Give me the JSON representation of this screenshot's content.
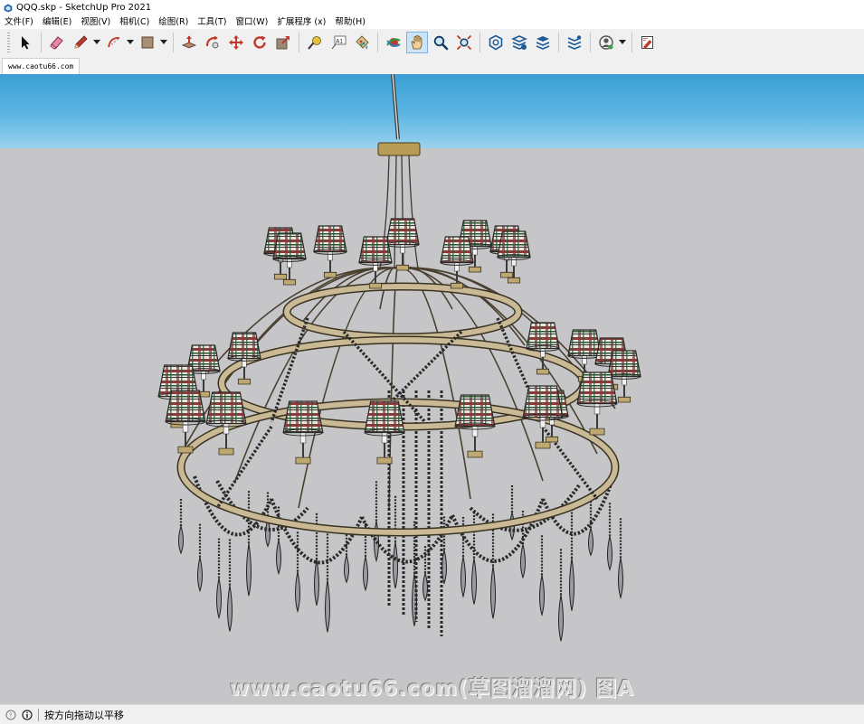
{
  "window": {
    "title": "QQQ.skp - SketchUp Pro 2021"
  },
  "menu": [
    {
      "label": "文件(F)"
    },
    {
      "label": "编辑(E)"
    },
    {
      "label": "视图(V)"
    },
    {
      "label": "相机(C)"
    },
    {
      "label": "绘图(R)"
    },
    {
      "label": "工具(T)"
    },
    {
      "label": "窗口(W)"
    },
    {
      "label": "扩展程序 (x)"
    },
    {
      "label": "帮助(H)"
    }
  ],
  "toolbar": {
    "tools": [
      {
        "name": "select-tool",
        "icon": "arrow-cursor-icon"
      },
      {
        "name": "eraser-tool",
        "icon": "eraser-icon"
      },
      {
        "name": "line-tool",
        "icon": "pencil-icon"
      },
      {
        "name": "arc-tool",
        "icon": "arc-icon"
      },
      {
        "name": "rectangle-tool",
        "icon": "rectangle-icon"
      },
      {
        "name": "push-pull-tool",
        "icon": "push-pull-icon"
      },
      {
        "name": "follow-me-tool",
        "icon": "follow-me-icon"
      },
      {
        "name": "move-tool",
        "icon": "move-icon"
      },
      {
        "name": "rotate-tool",
        "icon": "rotate-icon"
      },
      {
        "name": "scale-tool",
        "icon": "scale-icon"
      },
      {
        "name": "tape-measure-tool",
        "icon": "tape-measure-icon"
      },
      {
        "name": "text-tool",
        "icon": "text-icon"
      },
      {
        "name": "paint-bucket-tool",
        "icon": "paint-bucket-icon"
      },
      {
        "name": "orbit-tool",
        "icon": "orbit-icon"
      },
      {
        "name": "pan-tool",
        "icon": "pan-hand-icon",
        "active": true
      },
      {
        "name": "zoom-tool",
        "icon": "magnifier-icon"
      },
      {
        "name": "zoom-extents-tool",
        "icon": "zoom-extents-icon"
      },
      {
        "name": "warehouse-tool",
        "icon": "warehouse-icon"
      },
      {
        "name": "share-model-tool",
        "icon": "share-model-icon"
      },
      {
        "name": "extension-warehouse-tool",
        "icon": "extension-warehouse-icon"
      },
      {
        "name": "trimble-connect-tool",
        "icon": "trimble-connect-icon"
      },
      {
        "name": "account-tool",
        "icon": "account-icon"
      },
      {
        "name": "layout-tool",
        "icon": "send-to-layout-icon"
      }
    ],
    "text_tool_glyph": "A1"
  },
  "scene_tab": {
    "label": "www.caotu66.com"
  },
  "viewport": {
    "sky_color": "#4aa9dd",
    "ground_color": "#c6c6c9",
    "model": "chandelier with plaid lampshades",
    "shade_colors": [
      "#8a3a3a",
      "#e9e6df",
      "#2f5a3a",
      "#3a3a3a"
    ],
    "watermark": "www.caotu66.com(草图溜溜网) 图A"
  },
  "status": {
    "message": "按方向拖动以平移"
  }
}
